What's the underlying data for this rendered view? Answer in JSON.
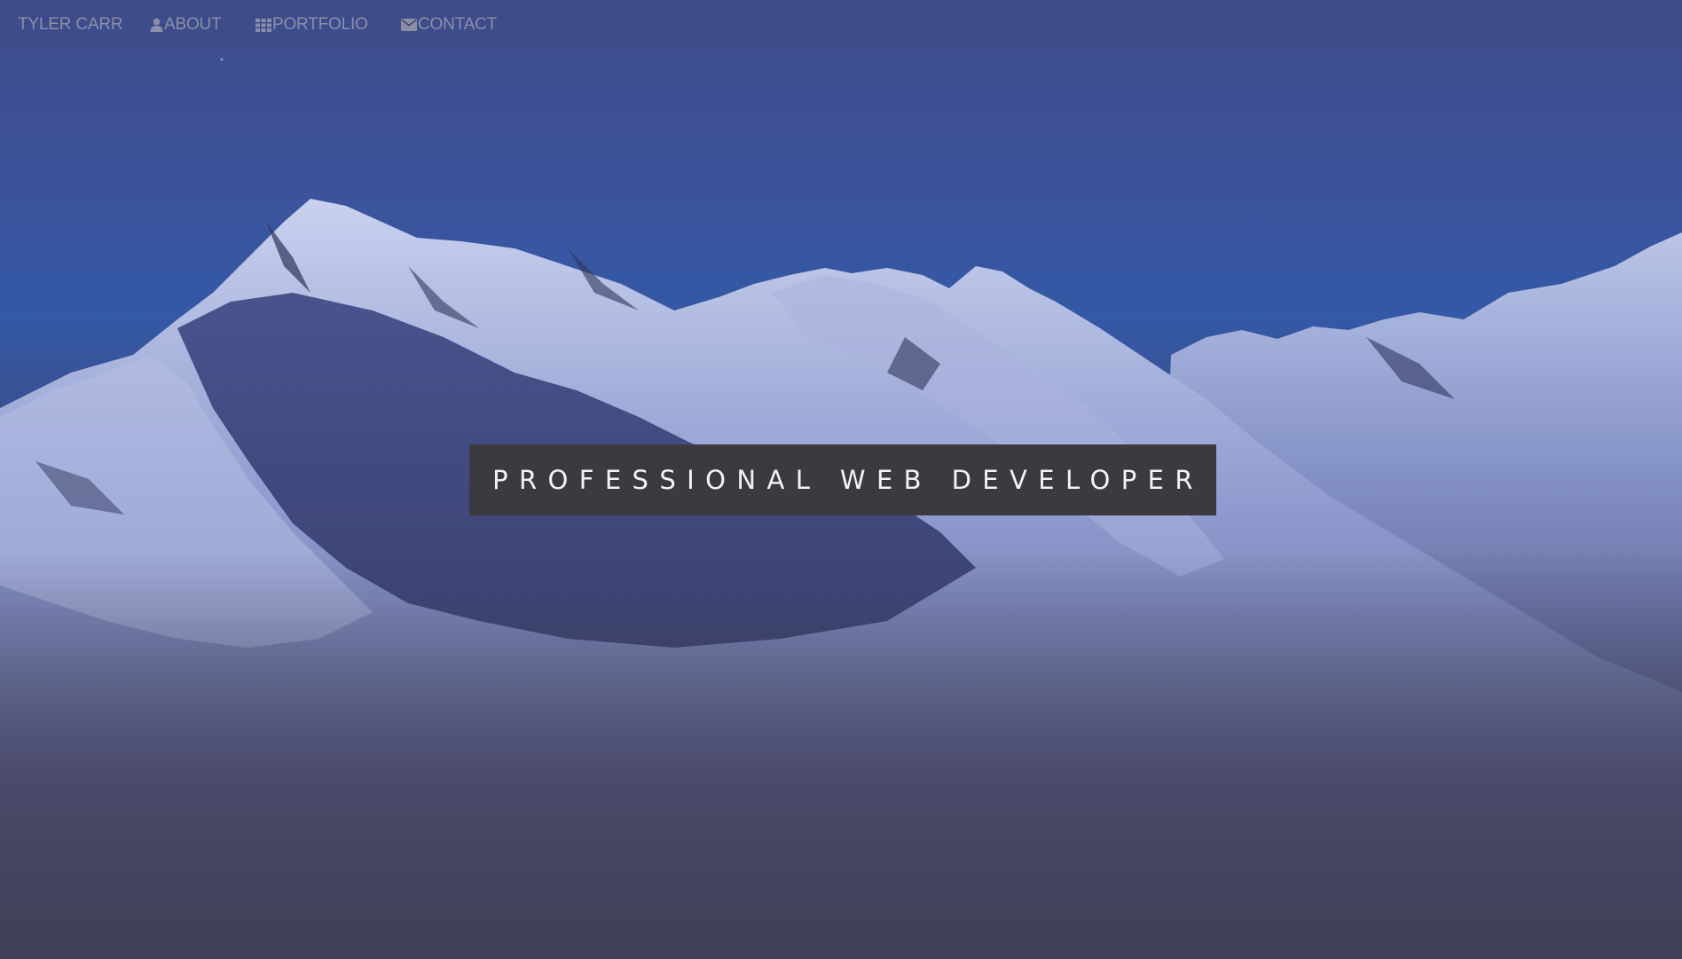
{
  "navbar": {
    "brand": "TYLER CARR",
    "items": [
      {
        "label": "ABOUT",
        "icon": "user-icon"
      },
      {
        "label": "PORTFOLIO",
        "icon": "grid-icon"
      },
      {
        "label": "CONTACT",
        "icon": "envelope-icon"
      }
    ]
  },
  "hero": {
    "tagline": "PROFESSIONAL WEB DEVELOPER",
    "background": "snowy-mountain-range-at-dusk"
  },
  "colors": {
    "nav_text": "#8c8ea8",
    "sky_top": "#3e4e8a",
    "sky_mid": "#3358a8",
    "page_bottom": "#41405a",
    "tagline_bg": "#3b3b3f",
    "tagline_text": "#f3f3f6"
  }
}
